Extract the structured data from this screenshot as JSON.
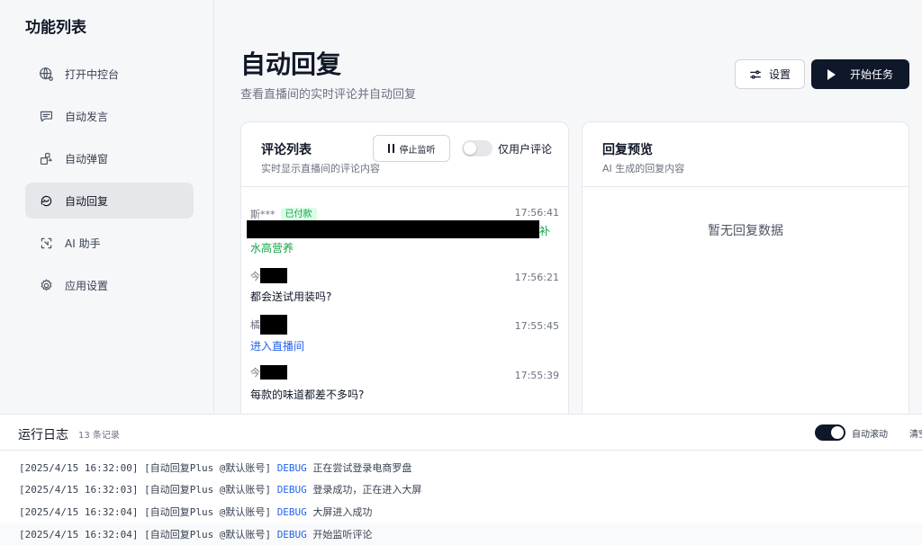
{
  "sidebar": {
    "title": "功能列表",
    "items": [
      {
        "label": "打开中控台"
      },
      {
        "label": "自动发言"
      },
      {
        "label": "自动弹窗"
      },
      {
        "label": "自动回复"
      },
      {
        "label": "AI 助手"
      },
      {
        "label": "应用设置"
      }
    ]
  },
  "header": {
    "title": "自动回复",
    "subtitle": "查看直播间的实时评论并自动回复",
    "settings_label": "设置",
    "start_label": "开始任务"
  },
  "comments_card": {
    "title": "评论列表",
    "desc": "实时显示直播间的评论内容",
    "stop_label": "停止监听",
    "user_only_label": "仅用户评论",
    "comments": [
      {
        "name": "斯***",
        "badge": "已付款",
        "time": "17:56:41",
        "text_tail": "补",
        "text_line2": "水高营养"
      },
      {
        "name": "今",
        "time": "17:56:21",
        "text": "都会送试用装吗?"
      },
      {
        "name": "橘",
        "time": "17:55:45",
        "text": "进入直播间"
      },
      {
        "name": "今",
        "time": "17:55:39",
        "text": "每款的味道都差不多吗?"
      }
    ]
  },
  "preview_card": {
    "title": "回复预览",
    "desc": "AI 生成的回复内容",
    "empty": "暂无回复数据"
  },
  "log": {
    "title": "运行日志",
    "count": "13 条记录",
    "autoscroll_label": "自动滚动",
    "clear_label": "清空",
    "lines": [
      {
        "prefix": "[2025/4/15 16:32:00] [自动回复Plus @默认账号]",
        "level": "DEBUG",
        "msg": "正在尝试登录电商罗盘"
      },
      {
        "prefix": "[2025/4/15 16:32:03] [自动回复Plus @默认账号]",
        "level": "DEBUG",
        "msg": "登录成功，正在进入大屏"
      },
      {
        "prefix": "[2025/4/15 16:32:04] [自动回复Plus @默认账号]",
        "level": "DEBUG",
        "msg": "大屏进入成功"
      },
      {
        "prefix": "[2025/4/15 16:32:04] [自动回复Plus @默认账号]",
        "level": "DEBUG",
        "msg": "开始监听评论"
      }
    ]
  },
  "colors": {
    "accent": "#0f172a",
    "paid_badge": "#16a34a",
    "link": "#2563eb"
  }
}
